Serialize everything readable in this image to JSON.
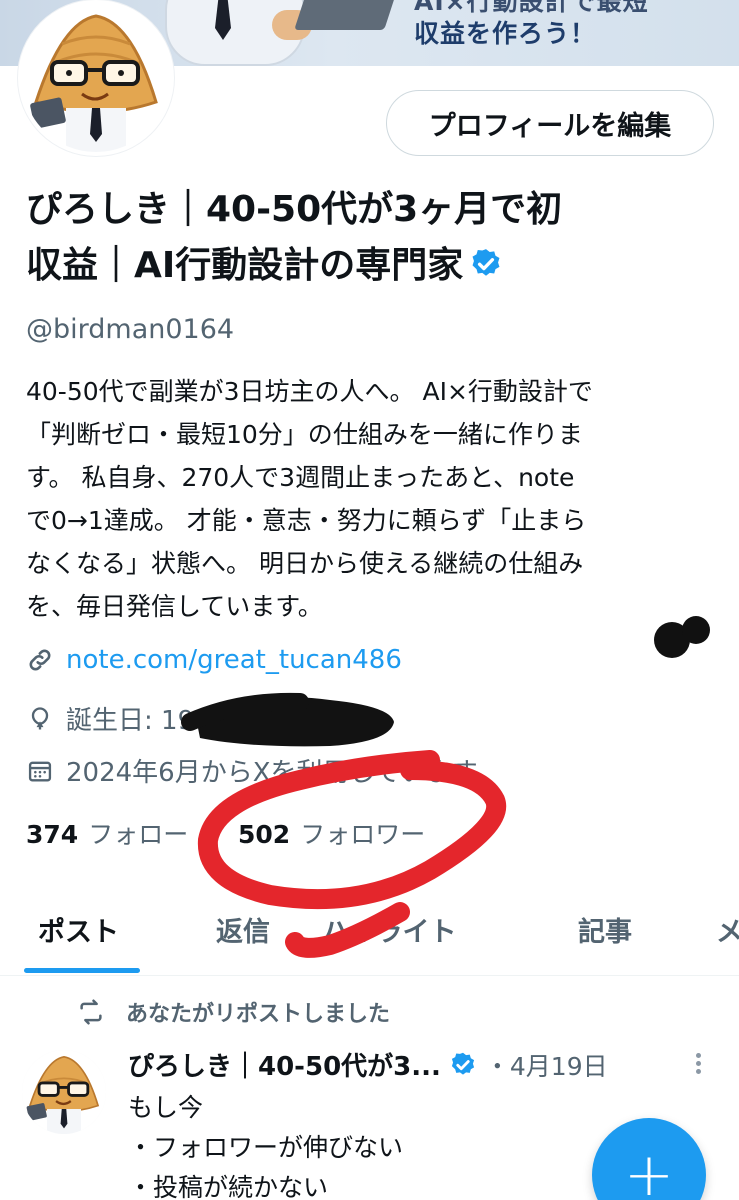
{
  "banner": {
    "line1": "AI×行動設計で最短",
    "line2": "収益を作ろう！"
  },
  "profile": {
    "edit_button": "プロフィールを編集",
    "name_line1": "ぴろしき｜40-50代が3ヶ月で初",
    "name_line2": "収益｜AI行動設計の専門家",
    "handle": "@birdman0164",
    "bio_lines": [
      "40-50代で副業が3日坊主の人へ。 AI×行動設計で",
      "「判断ゼロ・最短10分」の仕組みを一緒に作りま",
      "す。 私自身、270人で3週間止まったあと、note",
      "で0→1達成。 才能・意志・努力に頼らず「止まら",
      "なくなる」状態へ。 明日から使える継続の仕組み",
      "を、毎日発信しています。"
    ],
    "link": "note.com/great_tucan486",
    "birthday_label": "誕生日: 19",
    "joined": "2024年6月からXを利用しています",
    "following_count": "374",
    "following_label": "フォロー",
    "followers_count": "502",
    "followers_label": "フォロワー"
  },
  "icons": {
    "verified": "verified-badge-icon",
    "link": "link-icon",
    "birthday": "balloon-icon",
    "joined": "calendar-icon",
    "repost": "repost-icon",
    "more": "more-dots-icon",
    "compose": "plus-icon"
  },
  "tabs": [
    {
      "label": "ポスト",
      "active": true
    },
    {
      "label": "返信",
      "active": false
    },
    {
      "label": "ハイライト",
      "active": false
    },
    {
      "label": "記事",
      "active": false
    },
    {
      "label": "メ",
      "active": false
    }
  ],
  "post": {
    "repost_label": "あなたがリポストしました",
    "author": "ぴろしき｜40-50代が3...",
    "date": "・4月19日",
    "lines": [
      "もし今",
      "・フォロワーが伸びない",
      "・投稿が続かない"
    ]
  },
  "fab": {
    "label": "+"
  },
  "colors": {
    "accent": "#1d9bf0",
    "text": "#0f1419",
    "muted": "#536471",
    "marker": "#e4262c"
  }
}
